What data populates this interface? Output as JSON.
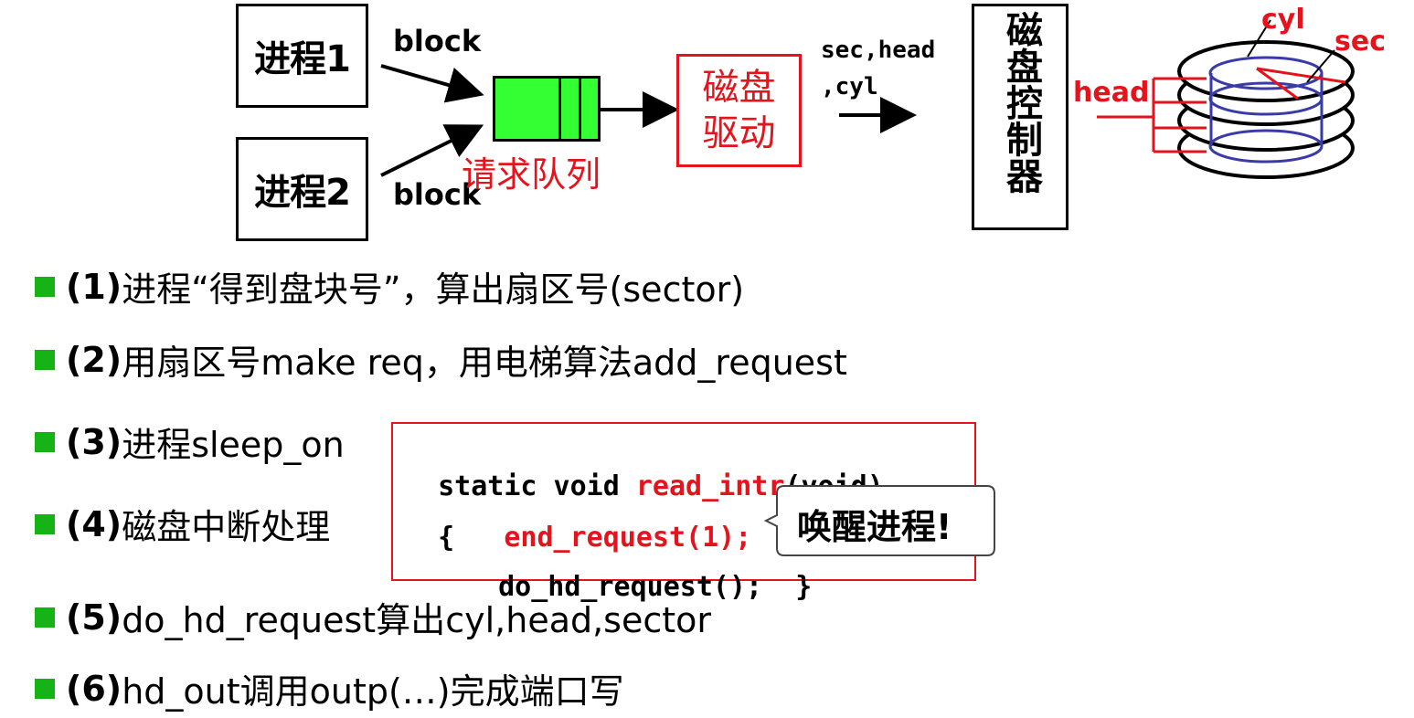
{
  "diagram": {
    "process1": "进程1",
    "process2": "进程2",
    "block_top": "block",
    "block_bottom": "block",
    "queue_label": "请求队列",
    "driver_label": "磁盘驱动",
    "driver_line1": "磁盘",
    "driver_line2": "驱动",
    "sec_head_line1": "sec,head",
    "sec_head_line2": ",cyl",
    "controller_label": "磁盘控制器",
    "disk_cyl": "cyl",
    "disk_sec": "sec",
    "disk_head": "head"
  },
  "steps": [
    {
      "num": "(1)",
      "text": " 进程“得到盘块号”，算出扇区号(sector)"
    },
    {
      "num": "(2)",
      "text": " 用扇区号make req，用电梯算法add_request"
    },
    {
      "num": "(3)",
      "text": " 进程sleep_on"
    },
    {
      "num": "(4)",
      "text": " 磁盘中断处理"
    },
    {
      "num": "(5)",
      "text": " do_hd_request算出cyl,head,sector"
    },
    {
      "num": "(6)",
      "text": " hd_out调用outp(…)完成端口写"
    }
  ],
  "code": {
    "l1_a": "static void ",
    "l1_fn": "read_intr",
    "l1_b": "(void)",
    "l2_brace": "{",
    "l2_call": "end_request(1);",
    "l3": "do_hd_request();",
    "l3_end": "}"
  },
  "callout": "唤醒进程!",
  "colors": {
    "accent_red": "#e5131b",
    "bullet_green": "#16b316",
    "queue_green": "#33ff33"
  }
}
